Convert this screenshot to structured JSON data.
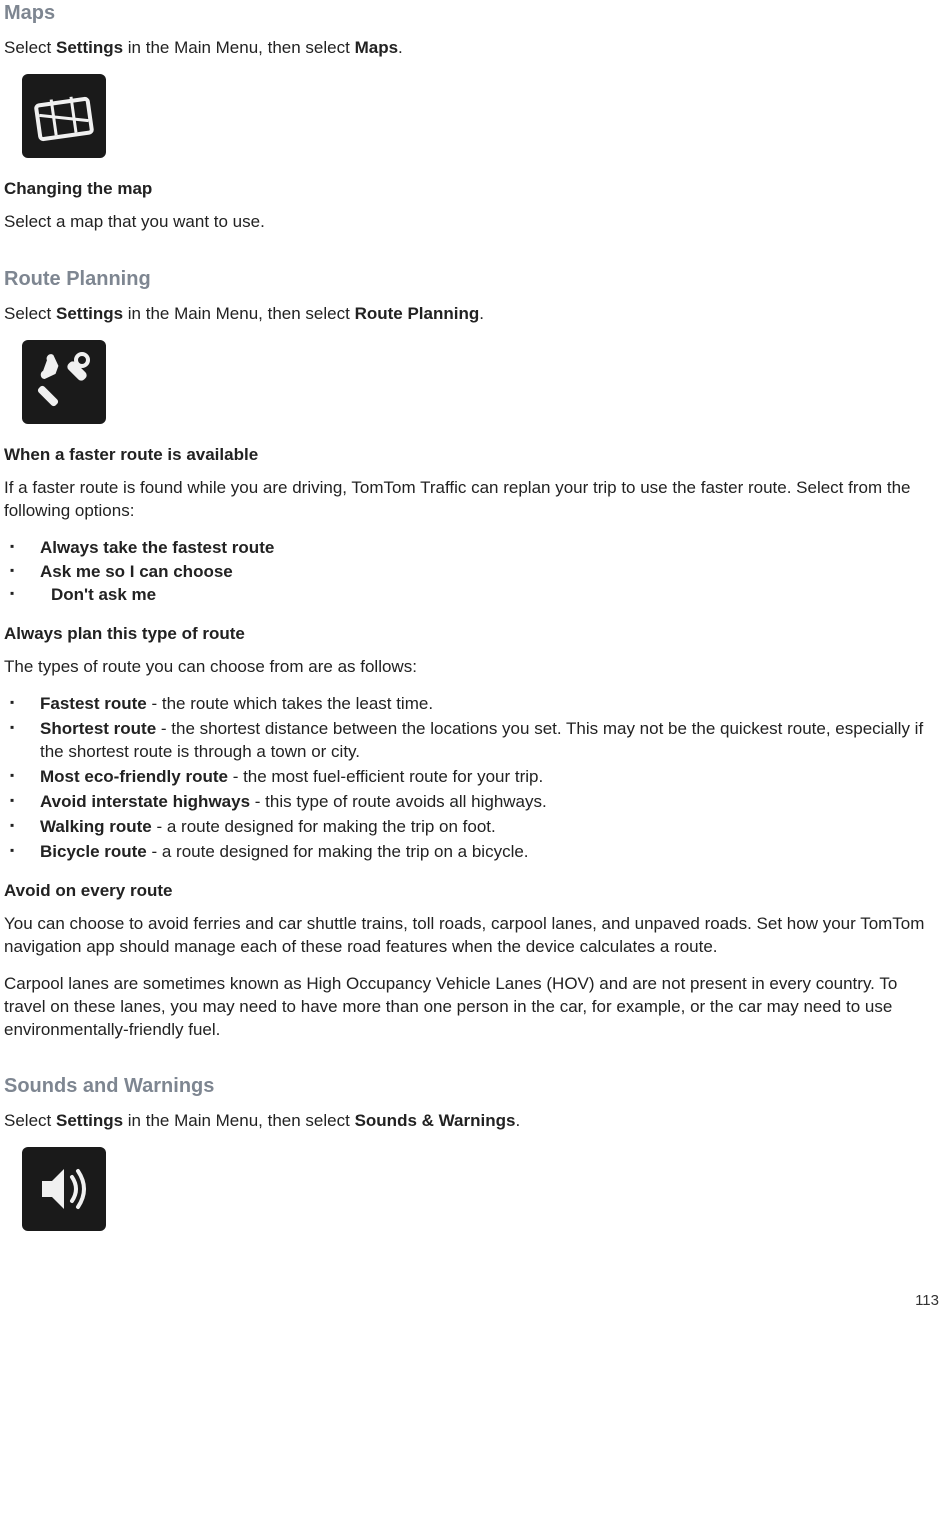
{
  "maps": {
    "title": "Maps",
    "select_prefix": "Select ",
    "select_bold1": "Settings",
    "select_mid": " in the Main Menu, then select ",
    "select_bold2": "Maps",
    "select_suffix": ".",
    "changing_title": "Changing the map",
    "changing_text": "Select a map that you want to use."
  },
  "route": {
    "title": "Route Planning",
    "select_prefix": "Select ",
    "select_bold1": "Settings",
    "select_mid": " in the Main Menu, then select ",
    "select_bold2": "Route Planning",
    "select_suffix": ".",
    "faster_title": "When a faster route is available",
    "faster_text": "If a faster route is found while you are driving, TomTom Traffic can replan your trip to use the faster route. Select from the following options:",
    "faster_options": [
      "Always take the fastest route",
      "Ask me so I can choose",
      "Don't ask me"
    ],
    "always_title": "Always plan this type of route",
    "always_intro": "The types of route you can choose from are as follows:",
    "route_types": [
      {
        "label": "Fastest route",
        "desc": " - the route which takes the least time."
      },
      {
        "label": "Shortest route",
        "desc": " - the shortest distance between the locations you set. This may not be the quickest route, especially if the shortest route is through a town or city."
      },
      {
        "label": "Most eco-friendly route",
        "desc": " - the most fuel-efficient route for your trip."
      },
      {
        "label": "Avoid interstate highways",
        "desc": " - this type of route avoids all highways."
      },
      {
        "label": "Walking route",
        "desc": " - a route designed for making the trip on foot."
      },
      {
        "label": "Bicycle route",
        "desc": " - a route designed for making the trip on a bicycle."
      }
    ],
    "avoid_title": "Avoid on every route",
    "avoid_p1": "You can choose to avoid ferries and car shuttle trains, toll roads, carpool lanes, and unpaved roads. Set how your TomTom navigation app should manage each of these road features when the device calculates a route.",
    "avoid_p2": "Carpool lanes are sometimes known as High Occupancy Vehicle Lanes (HOV) and are not present in every country. To travel on these lanes, you may need to have more than one person in the car, for example, or the car may need to use environmentally-friendly fuel."
  },
  "sounds": {
    "title": "Sounds and Warnings",
    "select_prefix": "Select ",
    "select_bold1": "Settings",
    "select_mid": " in the Main Menu, then select ",
    "select_bold2": "Sounds & Warnings",
    "select_suffix": "."
  },
  "page_number": "113"
}
